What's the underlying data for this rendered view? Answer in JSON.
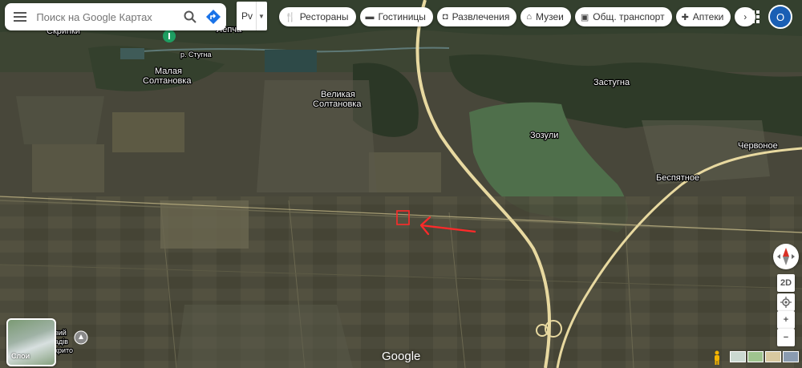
{
  "search": {
    "placeholder": "Поиск на Google Картах"
  },
  "language": {
    "label": "Рv"
  },
  "chips": [
    {
      "label": "Рестораны",
      "icon": "fork-knife-icon"
    },
    {
      "label": "Гостиницы",
      "icon": "bed-icon"
    },
    {
      "label": "Развлечения",
      "icon": "camera-icon"
    },
    {
      "label": "Музеи",
      "icon": "museum-icon"
    },
    {
      "label": "Общ. транспорт",
      "icon": "bus-icon"
    },
    {
      "label": "Аптеки",
      "icon": "pharmacy-icon"
    }
  ],
  "account": {
    "initial": "О"
  },
  "map_labels": {
    "skripki": "Скрипки",
    "lepcha": "Лепча",
    "malaya_1": "Малая",
    "malaya_2": "Солтановка",
    "velikaya_1": "Великая",
    "velikaya_2": "Солтановка",
    "zastugna": "Застугна",
    "zozuli": "Зозули",
    "chervonoe": "Червоное",
    "bespyatnoe": "Беспятное",
    "river": "р. Стугна",
    "bottom_left_1": "вий",
    "bottom_left_2": "адів",
    "bottom_left_3": "крито"
  },
  "layers": {
    "label": "Слои"
  },
  "attribution": {
    "logo": "Google"
  },
  "controls": {
    "tilt": "2D",
    "zoom_in": "+",
    "zoom_out": "−"
  },
  "colors": {
    "annotation": "#ff2a2a",
    "road": "#e8d9a0",
    "avatar": "#1a5fb4"
  }
}
